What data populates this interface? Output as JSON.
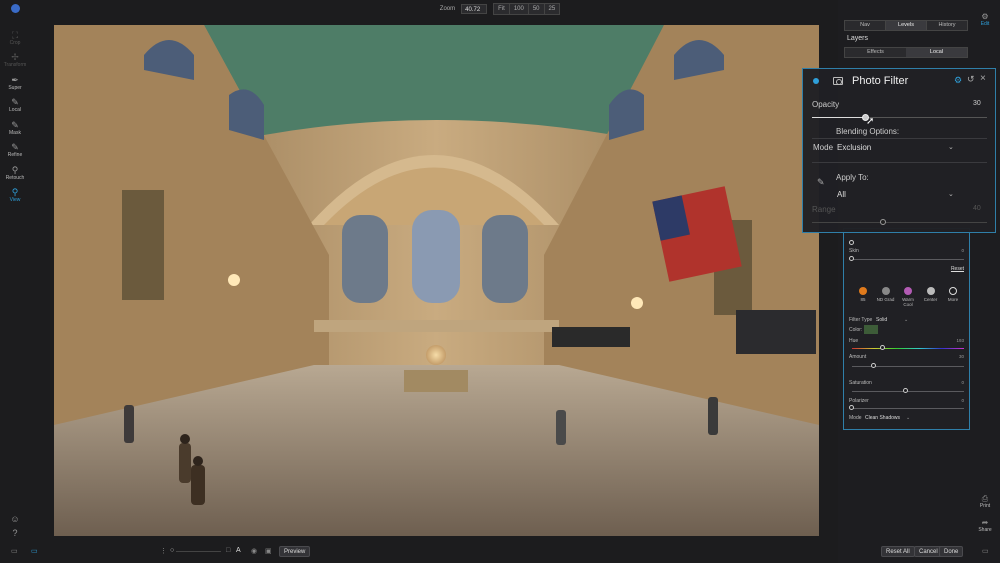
{
  "topbar": {
    "zoom_label": "Zoom",
    "zoom_value": "40.72",
    "zoom_buttons": [
      "Fit",
      "100",
      "50",
      "25"
    ]
  },
  "left_tools": [
    {
      "label": "Crop",
      "icon": "crop-icon",
      "glyph": "⛶",
      "state": "dim"
    },
    {
      "label": "Transform",
      "icon": "transform-icon",
      "glyph": "✢",
      "state": "dim"
    },
    {
      "label": "Super",
      "icon": "super-icon",
      "glyph": "✒",
      "state": "normal"
    },
    {
      "label": "Local",
      "icon": "local-brush-icon",
      "glyph": "✎",
      "state": "normal"
    },
    {
      "label": "Mask",
      "icon": "mask-icon",
      "glyph": "✎",
      "state": "normal"
    },
    {
      "label": "Refine",
      "icon": "refine-icon",
      "glyph": "✎",
      "state": "normal"
    },
    {
      "label": "Retouch",
      "icon": "retouch-icon",
      "glyph": "⚲",
      "state": "normal"
    },
    {
      "label": "View",
      "icon": "view-icon",
      "glyph": "⚲",
      "state": "active"
    }
  ],
  "right_panel": {
    "tabs": [
      "Nav",
      "Levels",
      "History"
    ],
    "active_tab": "Levels",
    "layers_title": "Layers",
    "layer_tabs": [
      "Effects",
      "Local"
    ],
    "active_layer_tab": "Local",
    "edit_label": "Edit",
    "skin_label": "Skin",
    "skin_value": "0",
    "reset_label": "Reset",
    "presets": [
      {
        "label": "85",
        "color": "#e07a1c"
      },
      {
        "label": "ND Grad",
        "color": "#888888"
      },
      {
        "label": "Warm Cool",
        "color": "#b35bb4"
      },
      {
        "label": "Center",
        "color": "#bbbbbb"
      },
      {
        "label": "More",
        "color": "#dddddd"
      }
    ],
    "filter_type_label": "Filter Type",
    "filter_type_value": "Solid",
    "color_label": "Color:",
    "color_value": "#3d5c38",
    "hue_label": "Hue",
    "hue_value": "193",
    "amount_label": "Amount",
    "amount_value": "30",
    "saturation_label": "Saturation",
    "saturation_value": "0",
    "polarizer_label": "Polarizer",
    "polarizer_value": "0",
    "mode_label": "Mode",
    "mode_value": "Clean Shadows",
    "print_label": "Print",
    "share_label": "Share"
  },
  "photo_filter": {
    "title": "Photo Filter",
    "opacity_label": "Opacity",
    "opacity_value": "30",
    "opacity_fraction": 0.3,
    "blending_label": "Blending Options:",
    "mode_label": "Mode",
    "mode_value": "Exclusion",
    "apply_to_label": "Apply To:",
    "apply_to_value": "All",
    "range_label": "Range",
    "range_value": "40"
  },
  "bottombar": {
    "preview_label": "Preview",
    "reset_all_label": "Reset All",
    "cancel_label": "Cancel",
    "done_label": "Done"
  },
  "colors": {
    "accent": "#2f9fd9",
    "background": "#1c1c1e",
    "panel_border": "#2f7fa9"
  }
}
